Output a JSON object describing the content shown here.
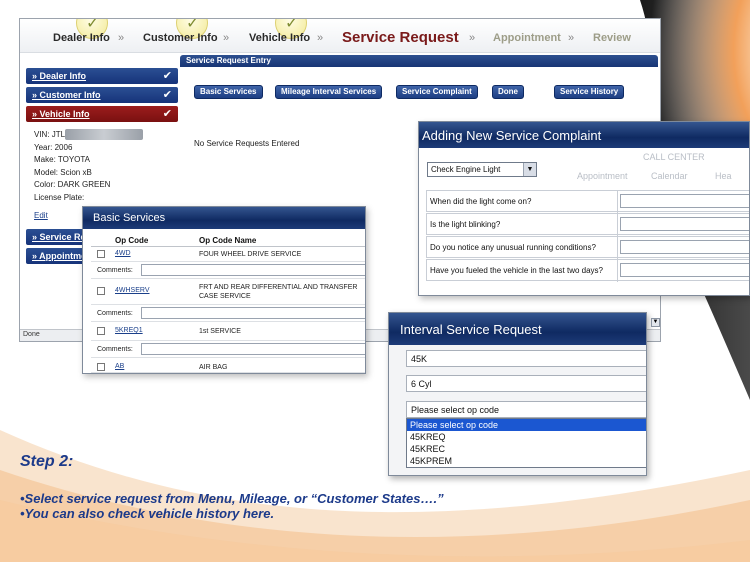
{
  "progress": {
    "steps": [
      "Dealer Info",
      "Customer Info",
      "Vehicle Info",
      "Service Request",
      "Appointment",
      "Review"
    ],
    "separator": "»"
  },
  "sidebar": {
    "items": [
      {
        "label": "» Dealer Info"
      },
      {
        "label": "» Customer Info"
      },
      {
        "label": "» Vehicle Info"
      }
    ],
    "vehicle": {
      "vin_label": "VIN: JTL",
      "year": "Year: 2006",
      "make": "Make: TOYOTA",
      "model": "Model: Scion xB",
      "color": "Color: DARK GREEN",
      "plate": "License Plate:"
    },
    "edit_label": "Edit",
    "lower_items": [
      "» Service Re",
      "» Appointme"
    ]
  },
  "main": {
    "header": "Service Request Entry",
    "buttons": [
      "Basic Services",
      "Mileage Interval Services",
      "Service Complaint",
      "Done",
      "Service History"
    ],
    "empty_text": "No Service Requests Entered"
  },
  "status_bar": "Done",
  "complaint": {
    "title": "Adding New Service Complaint",
    "selected": "Check Engine Light",
    "ghost_texts": [
      "CALL CENTER",
      "Appointment",
      "Calendar",
      "Hea"
    ],
    "questions": [
      "When did the light come on?",
      "Is the light blinking?",
      "Do you notice any unusual running conditions?",
      "Have you fueled the vehicle in the last two days?"
    ]
  },
  "basic_services": {
    "title": "Basic Services",
    "col_code": "Op Code",
    "col_name": "Op Code Name",
    "comments_label": "Comments:",
    "rows": [
      {
        "code": "4WD",
        "name": "FOUR WHEEL DRIVE SERVICE"
      },
      {
        "code": "4WHSERV",
        "name": "FRT AND REAR DIFFERENTIAL AND TRANSFER CASE SERVICE"
      },
      {
        "code": "5KREQ1",
        "name": "1st SERVICE"
      },
      {
        "code": "AB",
        "name": "AIR BAG"
      }
    ]
  },
  "interval": {
    "title": "Interval Service Request",
    "mileage": "45K",
    "engine": "6 Cyl",
    "select_value": "Please select op code",
    "options": [
      "Please select op code",
      "45KREQ",
      "45KREC",
      "45KPREM"
    ]
  },
  "caption": {
    "title": "Step 2:",
    "lines": [
      "•Select service request from Menu, Mileage, or “Customer States….”",
      "•You can also check vehicle history here."
    ]
  },
  "colors": {
    "nav_blue": "#1d3e83",
    "active_red": "#8a1515",
    "caption_blue": "#1c3a8a",
    "dialog_title": "#0f2a62",
    "selected_option": "#1b57d1"
  }
}
